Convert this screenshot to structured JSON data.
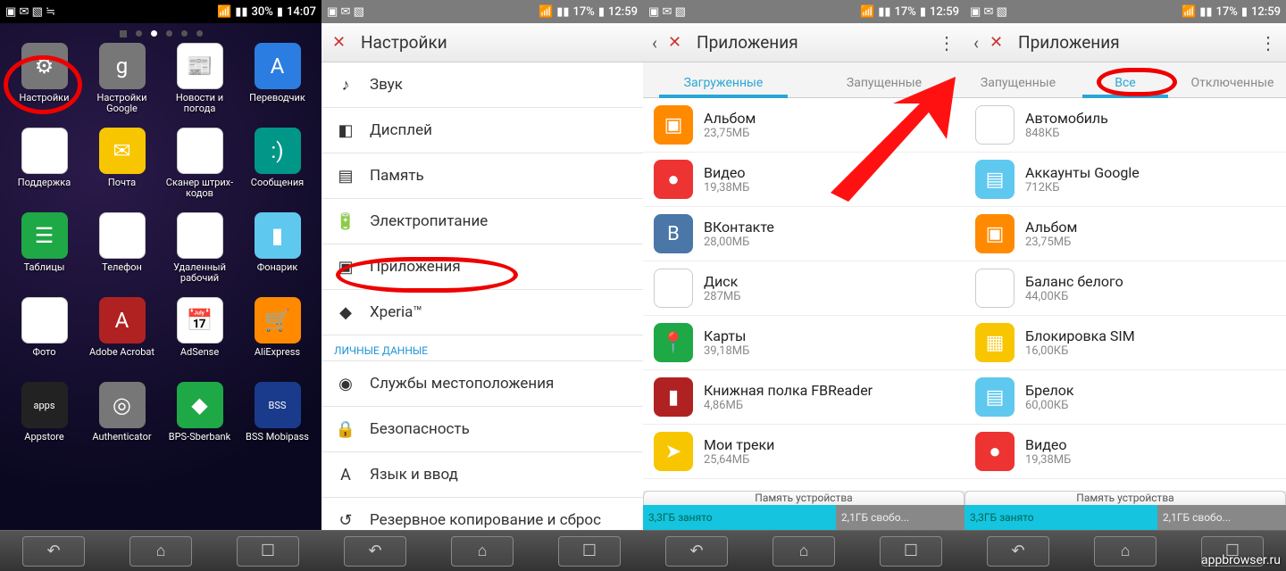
{
  "panel1": {
    "status": {
      "battery": "30%",
      "time": "14:07"
    },
    "apps": [
      {
        "label": "Настройки",
        "icon": "⚙",
        "color": "c-gray"
      },
      {
        "label": "Настройки Google",
        "icon": "g",
        "color": "c-gray"
      },
      {
        "label": "Новости и погода",
        "icon": "📰",
        "color": "c-white"
      },
      {
        "label": "Переводчик",
        "icon": "A",
        "color": "c-blue"
      },
      {
        "label": "Поддержка",
        "icon": "Xperia",
        "color": "c-white"
      },
      {
        "label": "Почта",
        "icon": "✉",
        "color": "c-yellow"
      },
      {
        "label": "Сканер штрих-кодов",
        "icon": "▮▮▮",
        "color": "c-white"
      },
      {
        "label": "Сообщения",
        "icon": ":)",
        "color": "c-teal"
      },
      {
        "label": "Таблицы",
        "icon": "☰",
        "color": "c-green"
      },
      {
        "label": "Телефон",
        "icon": "✆",
        "color": "c-white"
      },
      {
        "label": "Удаленный рабочий",
        "icon": "🖥",
        "color": "c-white"
      },
      {
        "label": "Фонарик",
        "icon": "▮",
        "color": "c-lblue"
      },
      {
        "label": "Фото",
        "icon": "✦",
        "color": "c-white"
      },
      {
        "label": "Adobe Acrobat",
        "icon": "A",
        "color": "c-dred"
      },
      {
        "label": "AdSense",
        "icon": "📅",
        "color": "c-white"
      },
      {
        "label": "AliExpress",
        "icon": "🛒",
        "color": "c-orange"
      },
      {
        "label": "Appstore",
        "icon": "apps",
        "color": "c-black"
      },
      {
        "label": "Authenticator",
        "icon": "◎",
        "color": "c-gray"
      },
      {
        "label": "BPS-Sberbank",
        "icon": "◆",
        "color": "c-green"
      },
      {
        "label": "BSS Mobipass",
        "icon": "BSS",
        "color": "c-dblue"
      }
    ]
  },
  "panel2": {
    "status": {
      "battery": "17%",
      "time": "12:59"
    },
    "title": "Настройки",
    "items": [
      {
        "label": "Звук",
        "icon": "♪"
      },
      {
        "label": "Дисплей",
        "icon": "◧"
      },
      {
        "label": "Память",
        "icon": "▤"
      },
      {
        "label": "Электропитание",
        "icon": "🔋"
      },
      {
        "label": "Приложения",
        "icon": "▣"
      },
      {
        "label": "Xperia™",
        "icon": "◆"
      }
    ],
    "section": "ЛИЧНЫЕ ДАННЫЕ",
    "items2": [
      {
        "label": "Службы местоположения",
        "icon": "◉"
      },
      {
        "label": "Безопасность",
        "icon": "🔒"
      },
      {
        "label": "Язык и ввод",
        "icon": "A"
      },
      {
        "label": "Резервное копирование и сброс",
        "icon": "↺"
      }
    ]
  },
  "panel3": {
    "status": {
      "battery": "17%",
      "time": "12:59"
    },
    "title": "Приложения",
    "tabs": [
      "Загруженные",
      "Запущенные"
    ],
    "active_tab": 0,
    "apps": [
      {
        "name": "Альбом",
        "size": "23,75МБ",
        "icon": "▣",
        "color": "c-orange"
      },
      {
        "name": "Видео",
        "size": "19,38МБ",
        "icon": "●",
        "color": "c-red"
      },
      {
        "name": "ВКонтакте",
        "size": "28,00МБ",
        "icon": "B",
        "color": "c-vk"
      },
      {
        "name": "Диск",
        "size": "287МБ",
        "icon": "▲",
        "color": "c-white"
      },
      {
        "name": "Карты",
        "size": "39,18МБ",
        "icon": "📍",
        "color": "c-green"
      },
      {
        "name": "Книжная полка FBReader",
        "size": "4,86МБ",
        "icon": "▮",
        "color": "c-dred"
      },
      {
        "name": "Мои треки",
        "size": "25,64МБ",
        "icon": "➤",
        "color": "c-yellow"
      }
    ],
    "storage": {
      "title": "Память устройства",
      "used": "3,3ГБ занято",
      "free": "2,1ГБ свобо..."
    }
  },
  "panel4": {
    "status": {
      "battery": "17%",
      "time": "12:59"
    },
    "title": "Приложения",
    "tabs": [
      "Запущенные",
      "Все",
      "Отключенные"
    ],
    "active_tab": 1,
    "apps": [
      {
        "name": "Автомобиль",
        "size": "848КБ",
        "icon": "◎",
        "color": "c-white"
      },
      {
        "name": "Аккаунты Google",
        "size": "712КБ",
        "icon": "▤",
        "color": "c-lblue"
      },
      {
        "name": "Альбом",
        "size": "23,75МБ",
        "icon": "▣",
        "color": "c-orange"
      },
      {
        "name": "Баланс белого",
        "size": "44,00КБ",
        "icon": "✕",
        "color": "c-white"
      },
      {
        "name": "Блокировка SIM",
        "size": "16,00КБ",
        "icon": "▦",
        "color": "c-yellow"
      },
      {
        "name": "Брелок",
        "size": "60,00КБ",
        "icon": "▤",
        "color": "c-lblue"
      },
      {
        "name": "Видео",
        "size": "19,38МБ",
        "icon": "●",
        "color": "c-red"
      }
    ],
    "storage": {
      "title": "Память устройства",
      "used": "3,3ГБ занято",
      "free": "2,1ГБ свобо..."
    }
  },
  "watermark": "appbrowser.ru"
}
